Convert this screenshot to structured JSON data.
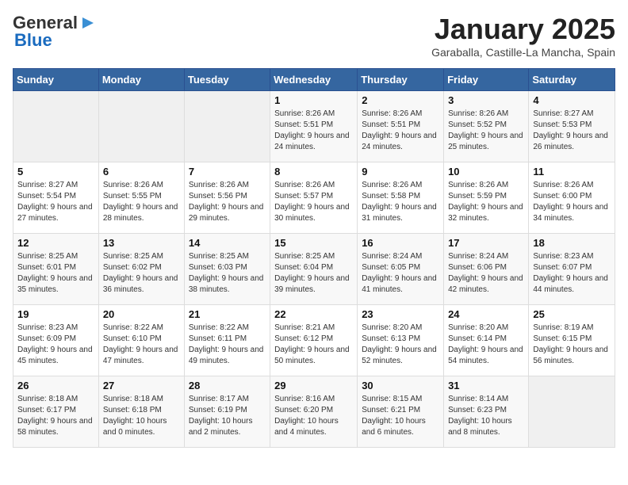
{
  "header": {
    "logo_general": "General",
    "logo_blue": "Blue",
    "month_title": "January 2025",
    "location": "Garaballa, Castille-La Mancha, Spain"
  },
  "weekdays": [
    "Sunday",
    "Monday",
    "Tuesday",
    "Wednesday",
    "Thursday",
    "Friday",
    "Saturday"
  ],
  "weeks": [
    [
      {
        "day": "",
        "info": ""
      },
      {
        "day": "",
        "info": ""
      },
      {
        "day": "",
        "info": ""
      },
      {
        "day": "1",
        "info": "Sunrise: 8:26 AM\nSunset: 5:51 PM\nDaylight: 9 hours and 24 minutes."
      },
      {
        "day": "2",
        "info": "Sunrise: 8:26 AM\nSunset: 5:51 PM\nDaylight: 9 hours and 24 minutes."
      },
      {
        "day": "3",
        "info": "Sunrise: 8:26 AM\nSunset: 5:52 PM\nDaylight: 9 hours and 25 minutes."
      },
      {
        "day": "4",
        "info": "Sunrise: 8:27 AM\nSunset: 5:53 PM\nDaylight: 9 hours and 26 minutes."
      }
    ],
    [
      {
        "day": "5",
        "info": "Sunrise: 8:27 AM\nSunset: 5:54 PM\nDaylight: 9 hours and 27 minutes."
      },
      {
        "day": "6",
        "info": "Sunrise: 8:26 AM\nSunset: 5:55 PM\nDaylight: 9 hours and 28 minutes."
      },
      {
        "day": "7",
        "info": "Sunrise: 8:26 AM\nSunset: 5:56 PM\nDaylight: 9 hours and 29 minutes."
      },
      {
        "day": "8",
        "info": "Sunrise: 8:26 AM\nSunset: 5:57 PM\nDaylight: 9 hours and 30 minutes."
      },
      {
        "day": "9",
        "info": "Sunrise: 8:26 AM\nSunset: 5:58 PM\nDaylight: 9 hours and 31 minutes."
      },
      {
        "day": "10",
        "info": "Sunrise: 8:26 AM\nSunset: 5:59 PM\nDaylight: 9 hours and 32 minutes."
      },
      {
        "day": "11",
        "info": "Sunrise: 8:26 AM\nSunset: 6:00 PM\nDaylight: 9 hours and 34 minutes."
      }
    ],
    [
      {
        "day": "12",
        "info": "Sunrise: 8:25 AM\nSunset: 6:01 PM\nDaylight: 9 hours and 35 minutes."
      },
      {
        "day": "13",
        "info": "Sunrise: 8:25 AM\nSunset: 6:02 PM\nDaylight: 9 hours and 36 minutes."
      },
      {
        "day": "14",
        "info": "Sunrise: 8:25 AM\nSunset: 6:03 PM\nDaylight: 9 hours and 38 minutes."
      },
      {
        "day": "15",
        "info": "Sunrise: 8:25 AM\nSunset: 6:04 PM\nDaylight: 9 hours and 39 minutes."
      },
      {
        "day": "16",
        "info": "Sunrise: 8:24 AM\nSunset: 6:05 PM\nDaylight: 9 hours and 41 minutes."
      },
      {
        "day": "17",
        "info": "Sunrise: 8:24 AM\nSunset: 6:06 PM\nDaylight: 9 hours and 42 minutes."
      },
      {
        "day": "18",
        "info": "Sunrise: 8:23 AM\nSunset: 6:07 PM\nDaylight: 9 hours and 44 minutes."
      }
    ],
    [
      {
        "day": "19",
        "info": "Sunrise: 8:23 AM\nSunset: 6:09 PM\nDaylight: 9 hours and 45 minutes."
      },
      {
        "day": "20",
        "info": "Sunrise: 8:22 AM\nSunset: 6:10 PM\nDaylight: 9 hours and 47 minutes."
      },
      {
        "day": "21",
        "info": "Sunrise: 8:22 AM\nSunset: 6:11 PM\nDaylight: 9 hours and 49 minutes."
      },
      {
        "day": "22",
        "info": "Sunrise: 8:21 AM\nSunset: 6:12 PM\nDaylight: 9 hours and 50 minutes."
      },
      {
        "day": "23",
        "info": "Sunrise: 8:20 AM\nSunset: 6:13 PM\nDaylight: 9 hours and 52 minutes."
      },
      {
        "day": "24",
        "info": "Sunrise: 8:20 AM\nSunset: 6:14 PM\nDaylight: 9 hours and 54 minutes."
      },
      {
        "day": "25",
        "info": "Sunrise: 8:19 AM\nSunset: 6:15 PM\nDaylight: 9 hours and 56 minutes."
      }
    ],
    [
      {
        "day": "26",
        "info": "Sunrise: 8:18 AM\nSunset: 6:17 PM\nDaylight: 9 hours and 58 minutes."
      },
      {
        "day": "27",
        "info": "Sunrise: 8:18 AM\nSunset: 6:18 PM\nDaylight: 10 hours and 0 minutes."
      },
      {
        "day": "28",
        "info": "Sunrise: 8:17 AM\nSunset: 6:19 PM\nDaylight: 10 hours and 2 minutes."
      },
      {
        "day": "29",
        "info": "Sunrise: 8:16 AM\nSunset: 6:20 PM\nDaylight: 10 hours and 4 minutes."
      },
      {
        "day": "30",
        "info": "Sunrise: 8:15 AM\nSunset: 6:21 PM\nDaylight: 10 hours and 6 minutes."
      },
      {
        "day": "31",
        "info": "Sunrise: 8:14 AM\nSunset: 6:23 PM\nDaylight: 10 hours and 8 minutes."
      },
      {
        "day": "",
        "info": ""
      }
    ]
  ]
}
